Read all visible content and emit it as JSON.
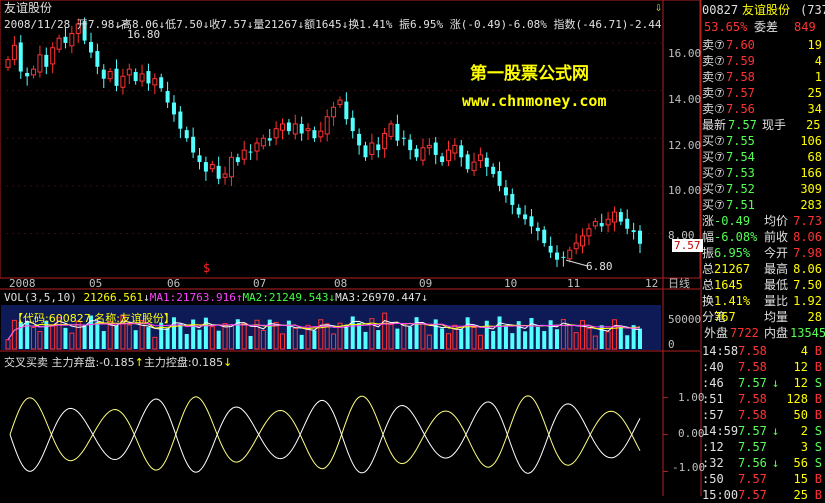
{
  "stock": {
    "name": "友谊股份",
    "code": "600827"
  },
  "info_bar": {
    "date": "2008/11/28",
    "open_label": "开",
    "open": "7.98",
    "high_label": "高",
    "high": "8.06",
    "low_label": "低",
    "low": "7.50",
    "close_label": "收",
    "close": "7.57",
    "vol_label": "量",
    "vol": "21267",
    "amt_label": "额",
    "amt": "1645",
    "turnover_label": "换",
    "turnover": "1.41%",
    "amp_label": "振",
    "amp": "6.95%",
    "chg_label": "涨",
    "chg": "(-0.49)-6.08%",
    "idx_label": "指数",
    "idx": "(-46.71)-2.44"
  },
  "watermark": {
    "line1": "第一股票公式网",
    "line2": "www.chnmoney.com"
  },
  "price_chart": {
    "y_ticks": [
      "16.00",
      "14.00",
      "12.00",
      "10.00",
      "8.00"
    ],
    "peak_label": "16.80",
    "trough_label": "6.80",
    "last_price_tag": "7.57",
    "signal_mark": "$",
    "x_labels": [
      "2008",
      "05",
      "06",
      "07",
      "08",
      "09",
      "10",
      "11",
      "12"
    ],
    "period_label": "日线",
    "up_color": "#ff3232",
    "down_color": "#54ffff"
  },
  "volume_panel": {
    "indicator": "VOL(3,5,10)",
    "vol_value": "21266.561",
    "ma1": "MA1:21763.916",
    "ma2": "MA2:21249.543",
    "ma3": "MA3:26970.447",
    "subtitle": "【代码:600827 名称:友谊股份】",
    "y_ticks": [
      "50000",
      "0"
    ]
  },
  "osc_panel": {
    "title": "交叉买卖",
    "main_sell": "主力弃盘:-0.185",
    "main_ctrl": "主力控盘:0.185",
    "y_ticks": [
      "1.00",
      "0.00",
      "-1.00"
    ]
  },
  "sidebar": {
    "header_code": "00827",
    "header_name": "友谊股份",
    "header_extra": "(737",
    "weibi_pct": "53.65%",
    "weibi_label": "委差",
    "weibi_value": "849",
    "asks": [
      {
        "label": "卖⑦",
        "price": "7.60",
        "vol": "19"
      },
      {
        "label": "卖⑦",
        "price": "7.59",
        "vol": "4"
      },
      {
        "label": "卖⑦",
        "price": "7.58",
        "vol": "1"
      },
      {
        "label": "卖⑦",
        "price": "7.57",
        "vol": "25"
      },
      {
        "label": "卖⑦",
        "price": "7.56",
        "vol": "34"
      }
    ],
    "latest_label": "最新",
    "latest": "7.57",
    "current_hand_label": "现手",
    "current_hand": "25",
    "bids": [
      {
        "label": "买⑦",
        "price": "7.55",
        "vol": "106"
      },
      {
        "label": "买⑦",
        "price": "7.54",
        "vol": "68"
      },
      {
        "label": "买⑦",
        "price": "7.53",
        "vol": "166"
      },
      {
        "label": "买⑦",
        "price": "7.52",
        "vol": "309"
      },
      {
        "label": "买⑦",
        "price": "7.51",
        "vol": "283"
      }
    ],
    "stats": [
      {
        "l1": "涨",
        "v1": "-0.49",
        "l2": "均价",
        "v2": "7.73"
      },
      {
        "l1": "幅",
        "v1": "-6.08%",
        "l2": "前收",
        "v2": "8.06"
      },
      {
        "l1": "振",
        "v1": "6.95%",
        "l2": "今开",
        "v2": "7.98"
      },
      {
        "l1": "总",
        "v1": "21267",
        "l2": "最高",
        "v2": "8.06"
      },
      {
        "l1": "总",
        "v1": "1645",
        "l2": "最低",
        "v2": "7.50"
      },
      {
        "l1": "换",
        "v1": "1.41%",
        "l2": "量比",
        "v2": "1.92"
      },
      {
        "l1": "分笔",
        "v1": "767",
        "l2": "均量",
        "v2": "28"
      }
    ],
    "outer_label": "外盘",
    "outer": "7722",
    "inner_label": "内盘",
    "inner": "13545",
    "ticks": [
      {
        "time": "14:58",
        "price": "7.58",
        "arrow": "",
        "vol": "4",
        "side": "B"
      },
      {
        "time": ":40",
        "price": "7.58",
        "arrow": "",
        "vol": "12",
        "side": "B"
      },
      {
        "time": ":46",
        "price": "7.57",
        "arrow": "↓",
        "vol": "12",
        "side": "S"
      },
      {
        "time": ":51",
        "price": "7.58",
        "arrow": "",
        "vol": "128",
        "side": "B"
      },
      {
        "time": ":57",
        "price": "7.58",
        "arrow": "",
        "vol": "50",
        "side": "B"
      },
      {
        "time": "14:59",
        "price": "7.57",
        "arrow": "↓",
        "vol": "2",
        "side": "S"
      },
      {
        "time": ":12",
        "price": "7.57",
        "arrow": "",
        "vol": "3",
        "side": "S"
      },
      {
        "time": ":32",
        "price": "7.56",
        "arrow": "↓",
        "vol": "56",
        "side": "S"
      },
      {
        "time": ":50",
        "price": "7.57",
        "arrow": "",
        "vol": "15",
        "side": "B"
      },
      {
        "time": "15:00",
        "price": "7.57",
        "arrow": "",
        "vol": "25",
        "side": "B"
      }
    ]
  },
  "chart_data": [
    {
      "type": "candlestick",
      "title": "友谊股份",
      "x_labels": [
        "2008",
        "05",
        "06",
        "07",
        "08",
        "09",
        "10",
        "11",
        "12"
      ],
      "ylim": [
        6.3,
        17.3
      ],
      "y_ticks": [
        8,
        10,
        12,
        14,
        16
      ],
      "annotations": [
        {
          "label": "16.80",
          "value": 16.8
        },
        {
          "label": "6.80",
          "value": 6.8
        },
        {
          "label": "7.57",
          "value": 7.57
        }
      ],
      "closes": [
        15.3,
        15.9,
        14.8,
        14.6,
        14.9,
        15.5,
        15.0,
        15.8,
        16.2,
        16.0,
        16.4,
        16.8,
        16.1,
        15.6,
        15.0,
        14.5,
        14.8,
        14.2,
        14.6,
        14.9,
        14.4,
        14.7,
        14.3,
        14.5,
        14.1,
        13.5,
        13.0,
        12.4,
        12.0,
        11.4,
        11.0,
        10.6,
        10.9,
        10.3,
        10.5,
        11.2,
        11.0,
        11.5,
        11.4,
        11.8,
        12.0,
        11.9,
        12.4,
        12.6,
        12.3,
        12.6,
        12.2,
        12.4,
        12.0,
        12.3,
        12.9,
        13.3,
        13.6,
        12.8,
        12.3,
        11.7,
        11.2,
        11.8,
        11.5,
        12.2,
        12.6,
        11.9,
        12.0,
        11.5,
        11.2,
        11.6,
        11.7,
        11.3,
        11.0,
        11.5,
        11.7,
        11.2,
        10.7,
        11.0,
        11.3,
        10.8,
        10.5,
        10.0,
        9.6,
        9.2,
        8.8,
        8.6,
        8.3,
        8.1,
        7.6,
        7.2,
        6.9,
        7.0,
        7.3,
        7.6,
        7.9,
        8.2,
        8.5,
        8.3,
        8.6,
        8.9,
        8.5,
        8.2,
        8.06,
        7.57
      ]
    },
    {
      "type": "bar",
      "title": "VOL(3,5,10)",
      "series": [
        {
          "name": "VOL",
          "latest": 21266.561
        },
        {
          "name": "MA1",
          "latest": 21763.916
        },
        {
          "name": "MA2",
          "latest": 21249.543
        },
        {
          "name": "MA3",
          "latest": 26970.447
        }
      ],
      "y_ticks": [
        0,
        50000
      ]
    },
    {
      "type": "line",
      "title": "交叉买卖",
      "series": [
        {
          "name": "主力弃盘",
          "latest": -0.185
        },
        {
          "name": "主力控盘",
          "latest": 0.185
        }
      ],
      "y_ticks": [
        -1.0,
        0.0,
        1.0
      ],
      "ylim": [
        -1.5,
        1.8
      ]
    }
  ]
}
